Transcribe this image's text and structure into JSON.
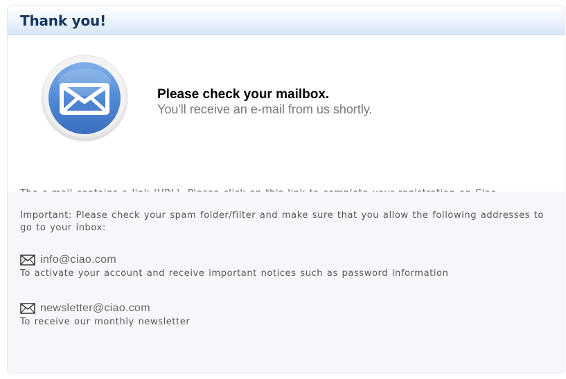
{
  "header": {
    "title": "Thank you!"
  },
  "confirmation": {
    "title": "Please check your mailbox.",
    "subtitle": "You'll receive an e-mail from us shortly.",
    "icon": "envelope-icon"
  },
  "intro_text": "The e-mail contains a link (URL). Please click on this link to complete your registration on Ciao.",
  "important": {
    "text": "Important: Please check your spam folder/filter and make sure that you allow the following addresses to go to your inbox:",
    "addresses": [
      {
        "email": "info@ciao.com",
        "description": "To activate your account and receive important notices such as password information",
        "icon": "mail-icon"
      },
      {
        "email": "newsletter@ciao.com",
        "description": "To receive our monthly newsletter",
        "icon": "mail-icon"
      }
    ]
  },
  "colors": {
    "header_title": "#14365c",
    "header_gradient_bottom": "#d6e6f6",
    "envelope_blue": "#5a8fd6",
    "important_background": "#f5f7fa"
  }
}
